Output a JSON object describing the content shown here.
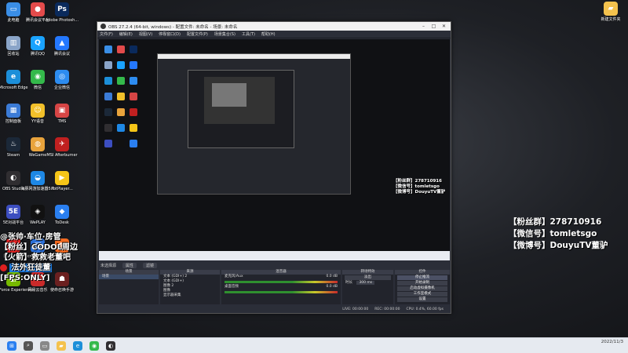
{
  "desktop": {
    "icons": [
      {
        "label": "此电脑",
        "color": "#3a8ee6",
        "glyph": "▭"
      },
      {
        "label": "腾讯会议平台",
        "color": "#e34b4b",
        "glyph": "●"
      },
      {
        "label": "Adobe Photosh...",
        "color": "#0a2a5c",
        "glyph": "Ps"
      },
      {
        "label": "回收站",
        "color": "#8aa4c8",
        "glyph": "▥"
      },
      {
        "label": "腾讯QQ",
        "color": "#1aa3ff",
        "glyph": "Q"
      },
      {
        "label": "腾讯会议",
        "color": "#2478ff",
        "glyph": "▲"
      },
      {
        "label": "Microsoft Edge",
        "color": "#1c8fd9",
        "glyph": "e"
      },
      {
        "label": "微信",
        "color": "#34b94b",
        "glyph": "◉"
      },
      {
        "label": "企业微信",
        "color": "#2d8cf0",
        "glyph": "◎"
      },
      {
        "label": "控制面板",
        "color": "#3b7bd6",
        "glyph": "▦"
      },
      {
        "label": "YY语音",
        "color": "#f2c02a",
        "glyph": "☺"
      },
      {
        "label": "TMS",
        "color": "#d64545",
        "glyph": "▣"
      },
      {
        "label": "Steam",
        "color": "#1b2838",
        "glyph": "♨"
      },
      {
        "label": "WeGame",
        "color": "#e8a33c",
        "glyph": "◍"
      },
      {
        "label": "MSI Afterburner",
        "color": "#c02020",
        "glyph": "✈"
      },
      {
        "label": "OBS Studio",
        "color": "#302e31",
        "glyph": "◐"
      },
      {
        "label": "海豚网游加速器5.0",
        "color": "#1e88e5",
        "glyph": "◒"
      },
      {
        "label": "PotPlayer...",
        "color": "#f5c518",
        "glyph": "▶"
      },
      {
        "label": "5E对战平台",
        "color": "#3c4ec0",
        "glyph": "5E"
      },
      {
        "label": "WePLAY",
        "color": "#111111",
        "glyph": "◈"
      },
      {
        "label": "ToDesk",
        "color": "#2a7ff0",
        "glyph": "◆"
      },
      {
        "label": "网易云音乐",
        "color": "#e02424",
        "glyph": "◉"
      },
      {
        "label": "Microsoft Store",
        "color": "#2c6fd6",
        "glyph": "▤"
      },
      {
        "label": "斗鱼直播",
        "color": "#f26a21",
        "glyph": "鱼"
      },
      {
        "label": "GeForce Experience",
        "color": "#76b900",
        "glyph": "◭"
      },
      {
        "label": "网易云音乐",
        "color": "#c92a2a",
        "glyph": "♪"
      },
      {
        "label": "使命召唤手游",
        "color": "#6b2020",
        "glyph": "☗"
      }
    ],
    "right_folder": {
      "label": "新建文件夹",
      "color": "#f4c24d"
    }
  },
  "overlay": {
    "fans_group": "【粉丝群】278710916",
    "wechat": "【微信号】tomletsgo",
    "weibo": "【微博号】DouyuTV董驴"
  },
  "danmu": {
    "line1": "@张帅·车位·房管",
    "line2": "【粉丝】CODOL周边",
    "line3": "【火箭】救救老董吧",
    "line4": "法外狂徒董",
    "line5": "[FPS:ONLY]"
  },
  "obs": {
    "title": "OBS 27.2.4 (64-bit, windows) - 配置文件: 未命名 - 场景: 未命名",
    "menu": [
      "文件(F)",
      "编辑(E)",
      "视图(V)",
      "停靠窗口(D)",
      "配置文件(P)",
      "场景集合(S)",
      "工具(T)",
      "帮助(H)"
    ],
    "status_top": {
      "label": "未选择源",
      "btn1": "属性",
      "btn2": "滤镜"
    },
    "docks": {
      "scenes": {
        "title": "场景",
        "items": [
          "场景"
        ]
      },
      "sources": {
        "title": "来源",
        "items": [
          "文本 (GDI+) 2",
          "文本 (GDI+)",
          "图像 2",
          "图像",
          "显示器采集"
        ]
      },
      "mixer": {
        "title": "混音器",
        "ch1": "麦克风/Aux",
        "ch1_db": "0.0 dB",
        "ch2": "桌面音频",
        "ch2_db": "0.0 dB"
      },
      "transitions": {
        "title": "转场特效",
        "type": "淡出",
        "duration_label": "时长",
        "duration": "300 ms"
      },
      "controls": {
        "title": "控件",
        "buttons": [
          "停止推流",
          "开始录制",
          "启动虚拟摄像机",
          "工作室模式",
          "设置",
          "退出"
        ]
      }
    },
    "status_bottom": {
      "live": "LIVE: 00:00:00",
      "rec": "REC: 00:00:00",
      "cpu": "CPU: 0.4%, 60.00 fps"
    }
  },
  "taskbar": {
    "time": "2022/11/3"
  },
  "colors": {
    "accent": "#1f7ce0",
    "obs_bg": "#2b2e38"
  }
}
